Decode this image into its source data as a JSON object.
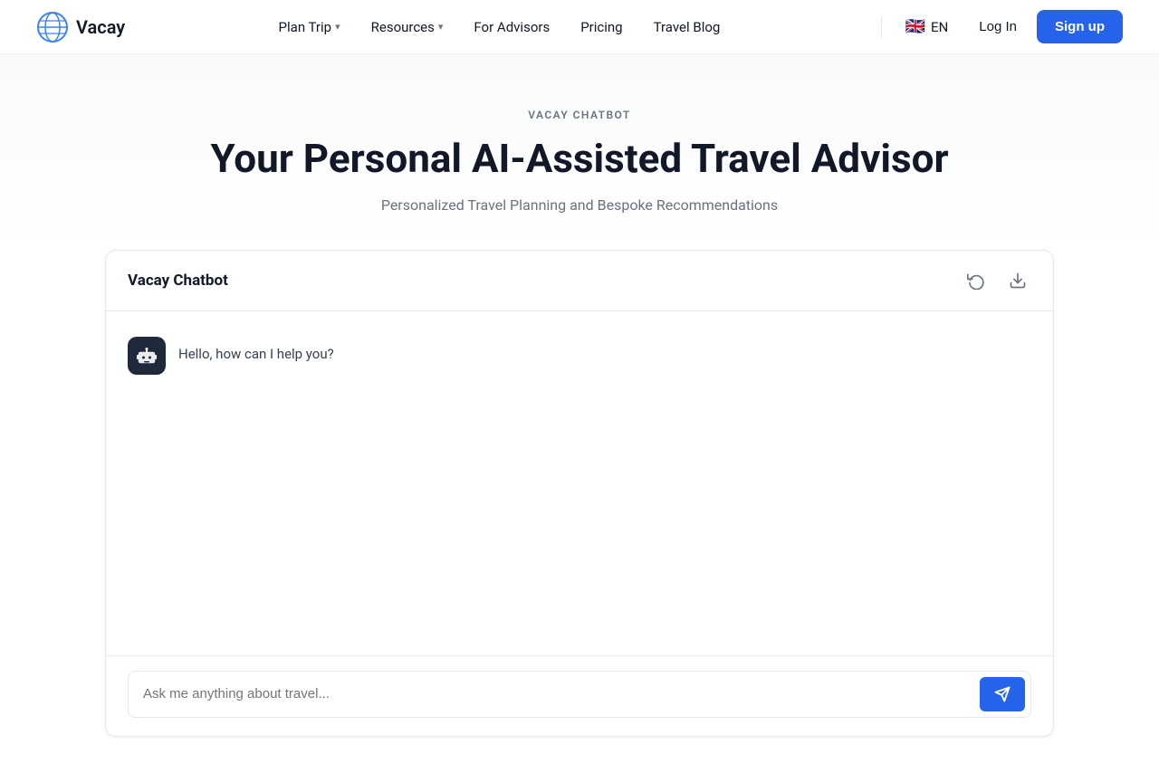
{
  "brand": {
    "logo_text": "Vacay",
    "logo_icon": "🌐"
  },
  "nav": {
    "links": [
      {
        "label": "Plan Trip",
        "has_dropdown": true
      },
      {
        "label": "Resources",
        "has_dropdown": true
      },
      {
        "label": "For Advisors",
        "has_dropdown": false
      },
      {
        "label": "Pricing",
        "has_dropdown": false
      },
      {
        "label": "Travel Blog",
        "has_dropdown": false
      }
    ],
    "language": "EN",
    "login_label": "Log In",
    "signup_label": "Sign up"
  },
  "hero": {
    "tag": "VACAY CHATBOT",
    "title": "Your Personal AI-Assisted Travel Advisor",
    "subtitle": "Personalized Travel Planning and Bespoke Recommendations"
  },
  "chatbot": {
    "panel_title": "Vacay Chatbot",
    "refresh_icon": "↺",
    "download_icon": "⬇",
    "bot_message": "Hello, how can I help you?",
    "input_placeholder": "Ask me anything about travel...",
    "send_icon": "➤"
  }
}
